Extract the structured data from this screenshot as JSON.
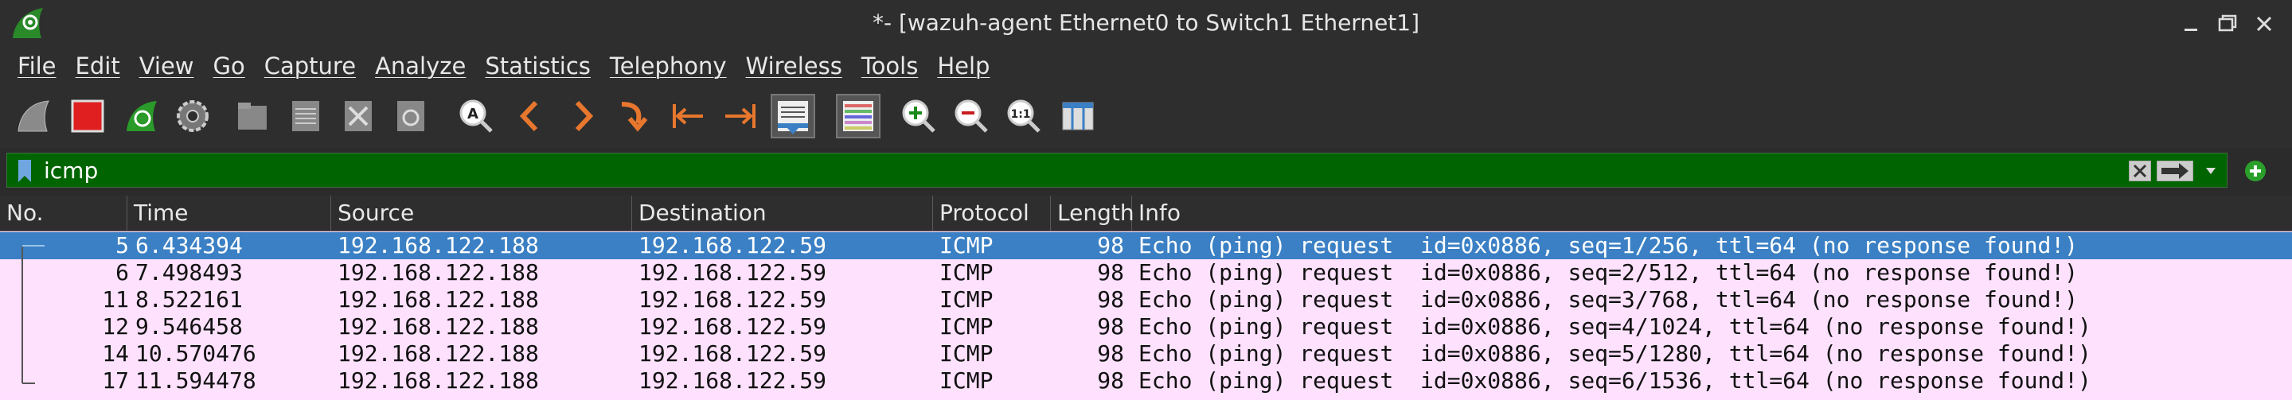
{
  "window": {
    "title": "*- [wazuh-agent Ethernet0 to Switch1 Ethernet1]"
  },
  "menu": [
    "File",
    "Edit",
    "View",
    "Go",
    "Capture",
    "Analyze",
    "Statistics",
    "Telephony",
    "Wireless",
    "Tools",
    "Help"
  ],
  "toolbar": {
    "icons": [
      "shark-fin-start-icon",
      "stop-capture-icon",
      "restart-capture-icon",
      "capture-options-icon",
      "open-file-icon",
      "save-file-icon",
      "close-file-icon",
      "reload-file-icon",
      "find-packet-icon",
      "go-back-icon",
      "go-forward-icon",
      "go-to-packet-icon",
      "first-packet-icon",
      "last-packet-icon",
      "autoscroll-icon",
      "colorize-icon",
      "zoom-in-icon",
      "zoom-out-icon",
      "normal-size-icon",
      "resize-columns-icon"
    ]
  },
  "filter": {
    "value": "icmp",
    "bg_color": "#006400"
  },
  "packet_list": {
    "headers": [
      "No.",
      "Time",
      "Source",
      "Destination",
      "Protocol",
      "Length",
      "Info"
    ],
    "rows": [
      {
        "no": "5",
        "time": "6.434394",
        "source": "192.168.122.188",
        "destination": "192.168.122.59",
        "protocol": "ICMP",
        "length": "98",
        "info": "Echo (ping) request  id=0x0886, seq=1/256, ttl=64 (no response found!)",
        "selected": true
      },
      {
        "no": "6",
        "time": "7.498493",
        "source": "192.168.122.188",
        "destination": "192.168.122.59",
        "protocol": "ICMP",
        "length": "98",
        "info": "Echo (ping) request  id=0x0886, seq=2/512, ttl=64 (no response found!)",
        "selected": false
      },
      {
        "no": "11",
        "time": "8.522161",
        "source": "192.168.122.188",
        "destination": "192.168.122.59",
        "protocol": "ICMP",
        "length": "98",
        "info": "Echo (ping) request  id=0x0886, seq=3/768, ttl=64 (no response found!)",
        "selected": false
      },
      {
        "no": "12",
        "time": "9.546458",
        "source": "192.168.122.188",
        "destination": "192.168.122.59",
        "protocol": "ICMP",
        "length": "98",
        "info": "Echo (ping) request  id=0x0886, seq=4/1024, ttl=64 (no response found!)",
        "selected": false
      },
      {
        "no": "14",
        "time": "10.570476",
        "source": "192.168.122.188",
        "destination": "192.168.122.59",
        "protocol": "ICMP",
        "length": "98",
        "info": "Echo (ping) request  id=0x0886, seq=5/1280, ttl=64 (no response found!)",
        "selected": false
      },
      {
        "no": "17",
        "time": "11.594478",
        "source": "192.168.122.188",
        "destination": "192.168.122.59",
        "protocol": "ICMP",
        "length": "98",
        "info": "Echo (ping) request  id=0x0886, seq=6/1536, ttl=64 (no response found!)",
        "selected": false
      }
    ],
    "row_color": "#fde1fd",
    "selected_color": "#3b80c4"
  }
}
